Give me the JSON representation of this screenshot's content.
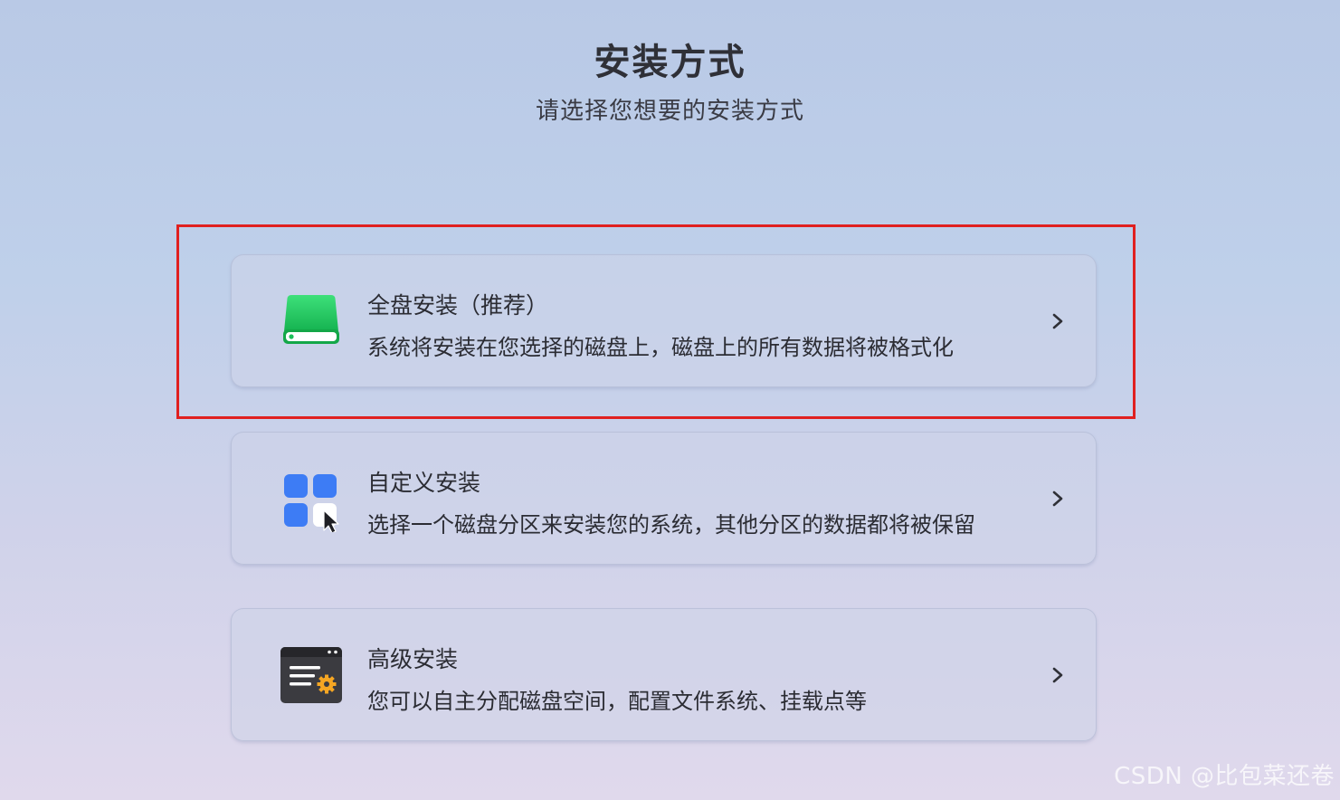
{
  "header": {
    "title": "安装方式",
    "subtitle": "请选择您想要的安装方式"
  },
  "options": [
    {
      "title": "全盘安装（推荐）",
      "description": "系统将安装在您选择的磁盘上，磁盘上的所有数据将被格式化",
      "icon": "hard-drive-icon",
      "highlighted": true
    },
    {
      "title": "自定义安装",
      "description": "选择一个磁盘分区来安装您的系统，其他分区的数据都将被保留",
      "icon": "custom-partition-icon",
      "highlighted": false
    },
    {
      "title": "高级安装",
      "description": "您可以自主分配磁盘空间，配置文件系统、挂载点等",
      "icon": "advanced-settings-icon",
      "highlighted": false
    }
  ],
  "watermark": "CSDN @比包菜还卷",
  "colors": {
    "highlight_border": "#e02020",
    "drive_green": "#22c463",
    "tile_blue": "#3d7cf5",
    "gear_orange": "#f5a623"
  }
}
